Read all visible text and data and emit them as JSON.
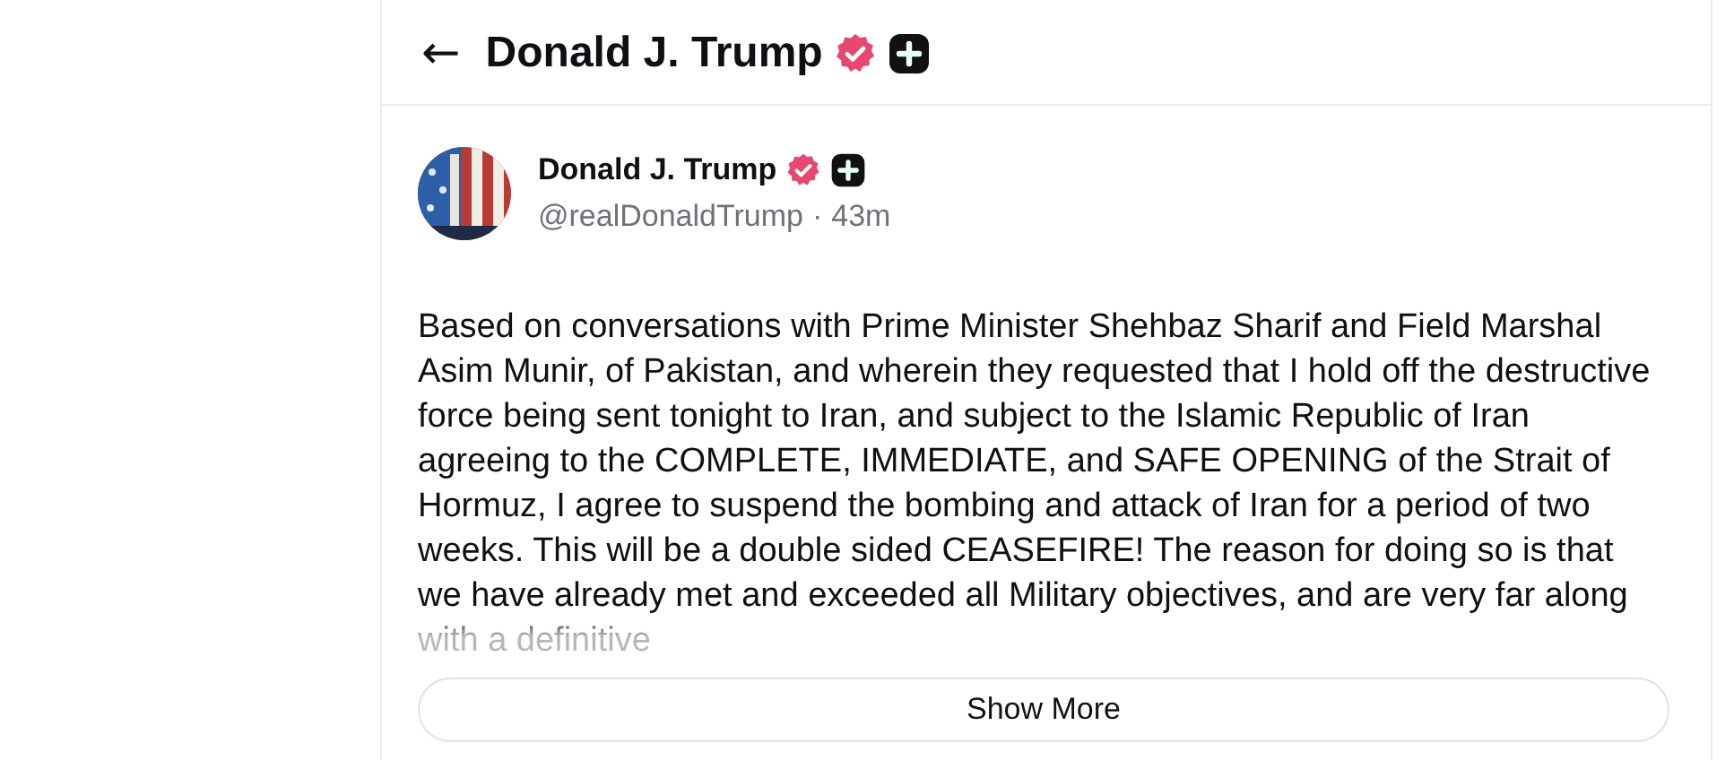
{
  "header": {
    "back": "←",
    "title": "Donald J. Trump",
    "verified": true,
    "plus_badge": true
  },
  "post": {
    "author": "Donald J. Trump",
    "verified": true,
    "plus_badge": true,
    "handle": "@realDonaldTrump",
    "separator": "·",
    "time": "43m",
    "body": "Based on conversations with Prime Minister Shehbaz Sharif and Field Marshal Asim Munir, of Pakistan, and wherein they requested that I hold off the destructive force being sent tonight to Iran, and subject to the Islamic Republic of Iran agreeing to the COMPLETE, IMMEDIATE, and SAFE OPENING of the Strait of Hormuz, I agree to suspend the bombing and attack of Iran for a period of two weeks. This will be a double sided CEASEFIRE! The reason for doing so is that we have already met and exceeded all Military objectives, and are very far along with a definitive",
    "show_more": "Show More"
  }
}
